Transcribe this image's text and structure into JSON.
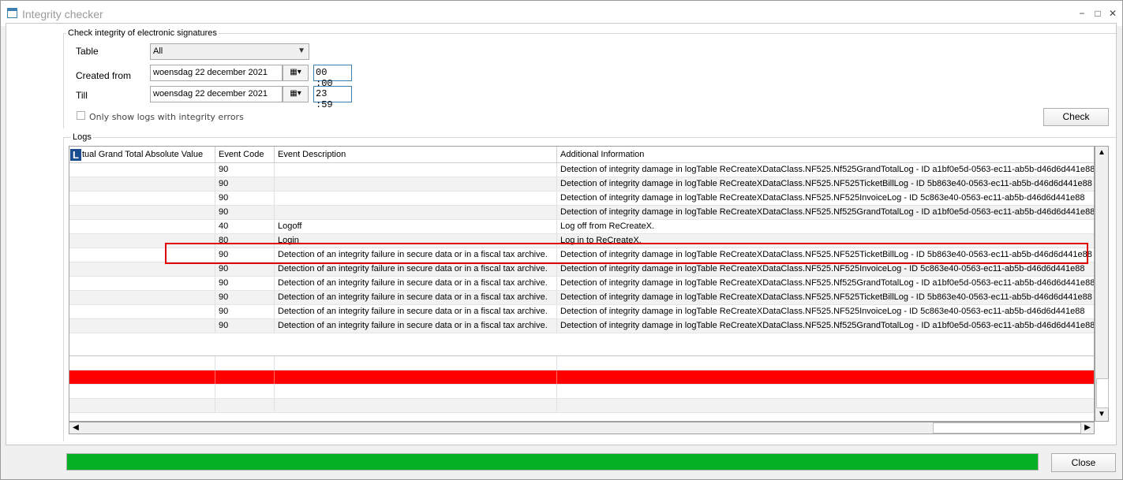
{
  "window": {
    "title": "Integrity checker",
    "controls": {
      "minimize": "−",
      "maximize": "□",
      "close": "✕"
    }
  },
  "criteria": {
    "group_label": "Check integrity of electronic signatures",
    "table_label": "Table",
    "table_value": "All",
    "created_from_label": "Created from",
    "created_from_date": "woensdag 22 december 2021",
    "created_from_time": "00 :00",
    "till_label": "Till",
    "till_date": "woensdag 22 december 2021",
    "till_time": "23 :59",
    "only_errors_label": "Only show logs with integrity errors",
    "only_errors_checked": false,
    "check_button": "Check"
  },
  "logs": {
    "group_label": "Logs",
    "badge": "L",
    "columns": [
      "tual Grand Total Absolute Value",
      "Event Code",
      "Event Description",
      "Additional Information"
    ],
    "rows": [
      {
        "value": "",
        "code": "90",
        "desc": "",
        "info": "Detection of integrity damage in logTable ReCreateXDataClass.NF525.Nf525GrandTotalLog - ID a1bf0e5d-0563-ec11-ab5b-d46d6d441e88"
      },
      {
        "value": "",
        "code": "90",
        "desc": "",
        "info": "Detection of integrity damage in logTable ReCreateXDataClass.NF525.NF525TicketBillLog - ID 5b863e40-0563-ec11-ab5b-d46d6d441e88"
      },
      {
        "value": "",
        "code": "90",
        "desc": "",
        "info": "Detection of integrity damage in logTable ReCreateXDataClass.NF525.NF525InvoiceLog - ID 5c863e40-0563-ec11-ab5b-d46d6d441e88"
      },
      {
        "value": "",
        "code": "90",
        "desc": "",
        "info": "Detection of integrity damage in logTable ReCreateXDataClass.NF525.Nf525GrandTotalLog - ID a1bf0e5d-0563-ec11-ab5b-d46d6d441e88"
      },
      {
        "value": "",
        "code": "40",
        "desc": "Logoff",
        "info": "Log off from ReCreateX."
      },
      {
        "value": "",
        "code": "80",
        "desc": "Login",
        "info": "Log in to ReCreateX."
      },
      {
        "value": "",
        "code": "90",
        "desc": "Detection of an integrity failure in secure data or in a fiscal tax archive.",
        "info": "Detection of integrity damage in logTable ReCreateXDataClass.NF525.NF525TicketBillLog - ID 5b863e40-0563-ec11-ab5b-d46d6d441e88"
      },
      {
        "value": "",
        "code": "90",
        "desc": "Detection of an integrity failure in secure data or in a fiscal tax archive.",
        "info": "Detection of integrity damage in logTable ReCreateXDataClass.NF525.NF525InvoiceLog - ID 5c863e40-0563-ec11-ab5b-d46d6d441e88"
      },
      {
        "value": "",
        "code": "90",
        "desc": "Detection of an integrity failure in secure data or in a fiscal tax archive.",
        "info": "Detection of integrity damage in logTable ReCreateXDataClass.NF525.Nf525GrandTotalLog - ID a1bf0e5d-0563-ec11-ab5b-d46d6d441e88"
      },
      {
        "value": "",
        "code": "90",
        "desc": "Detection of an integrity failure in secure data or in a fiscal tax archive.",
        "info": "Detection of integrity damage in logTable ReCreateXDataClass.NF525.NF525TicketBillLog - ID 5b863e40-0563-ec11-ab5b-d46d6d441e88"
      },
      {
        "value": "",
        "code": "90",
        "desc": "Detection of an integrity failure in secure data or in a fiscal tax archive.",
        "info": "Detection of integrity damage in logTable ReCreateXDataClass.NF525.NF525InvoiceLog - ID 5c863e40-0563-ec11-ab5b-d46d6d441e88"
      },
      {
        "value": "",
        "code": "90",
        "desc": "Detection of an integrity failure in secure data or in a fiscal tax archive.",
        "info": "Detection of integrity damage in logTable ReCreateXDataClass.NF525.Nf525GrandTotalLog - ID a1bf0e5d-0563-ec11-ab5b-d46d6d441e88"
      }
    ],
    "highlighted_row_index": 6,
    "error_row_color": "#ff0000"
  },
  "scroll": {
    "up": "▲",
    "down": "▼",
    "left": "◀",
    "right": "▶"
  },
  "progress": {
    "value": 1.0,
    "color": "#06b025"
  },
  "footer": {
    "close_button": "Close"
  },
  "icons": {
    "calendar": "calendar-icon",
    "dropdown": "chevron-down-icon"
  }
}
